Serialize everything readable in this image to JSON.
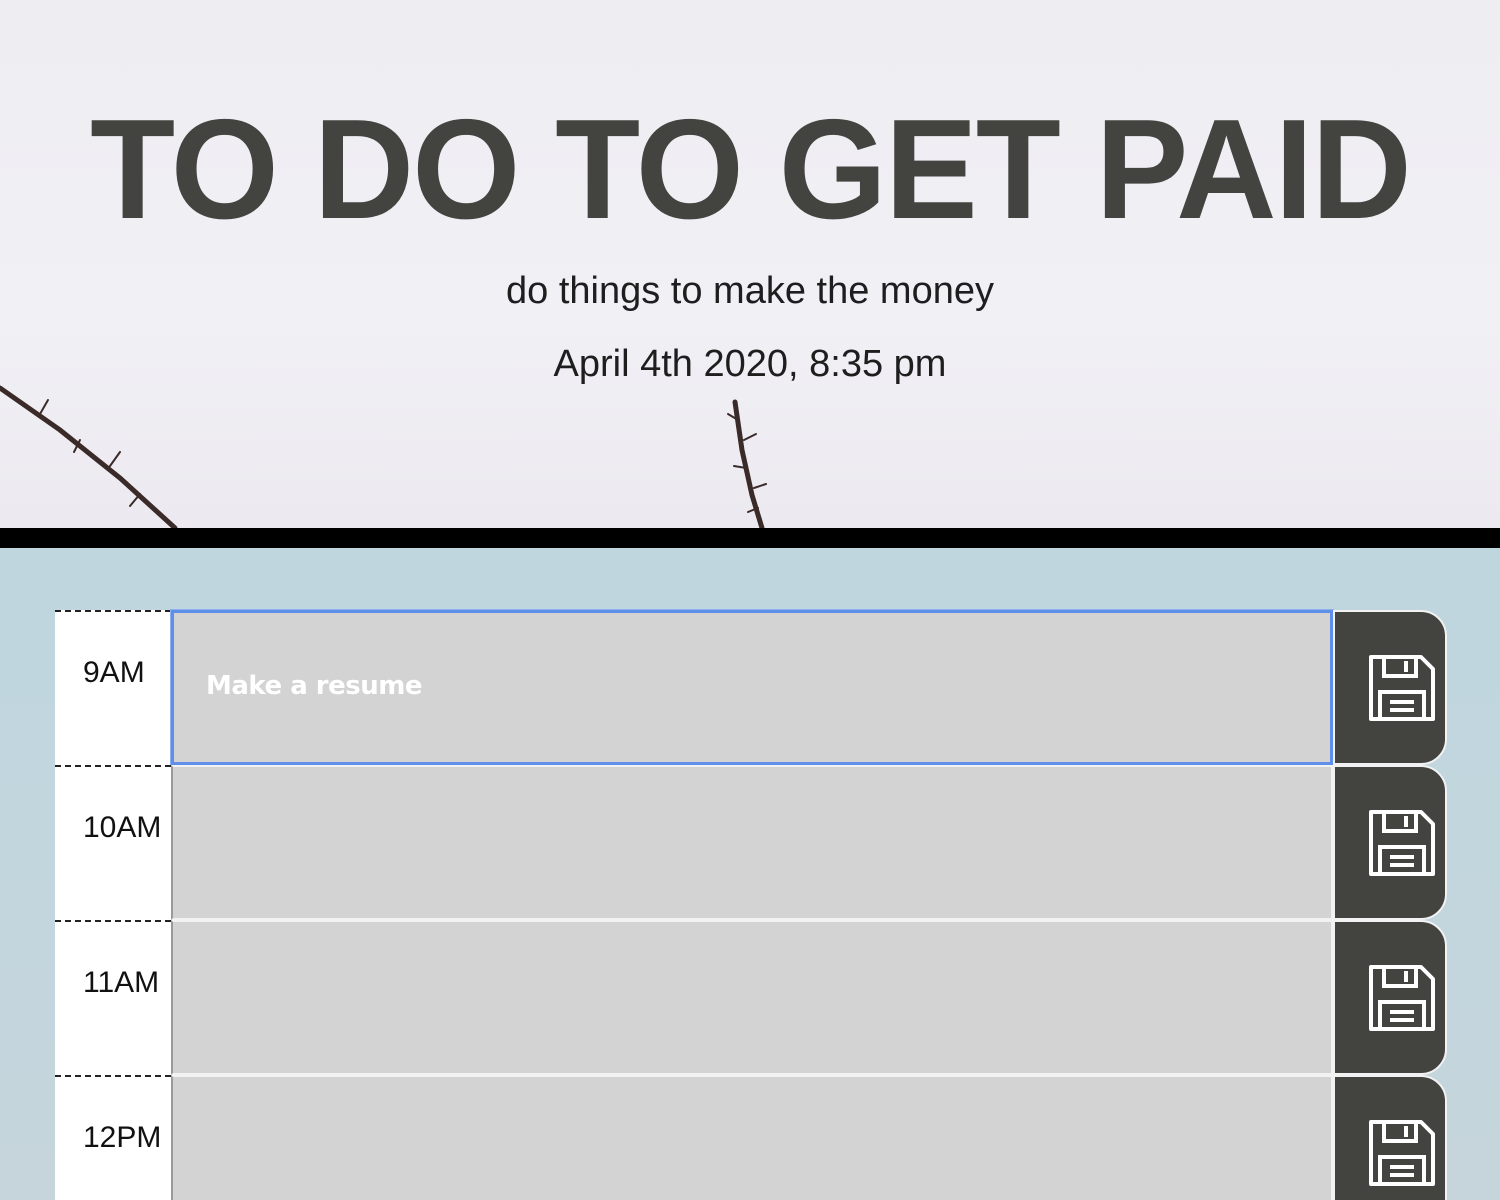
{
  "header": {
    "title": "TO DO TO GET PAID",
    "subtitle": "do things to make the money",
    "current_datetime": "April 4th 2020, 8:35 pm"
  },
  "schedule": [
    {
      "hour": "9AM",
      "task": "Make a resume",
      "save_icon": "floppy-disk-icon"
    },
    {
      "hour": "10AM",
      "task": "",
      "save_icon": "floppy-disk-icon"
    },
    {
      "hour": "11AM",
      "task": "",
      "save_icon": "floppy-disk-icon"
    },
    {
      "hour": "12PM",
      "task": "",
      "save_icon": "floppy-disk-icon"
    }
  ],
  "colors": {
    "title": "#434340",
    "save_button": "#434340",
    "task_area": "#d3d3d3",
    "planner_background": "#c3d7df",
    "focus_ring": "#5f8fe8"
  }
}
